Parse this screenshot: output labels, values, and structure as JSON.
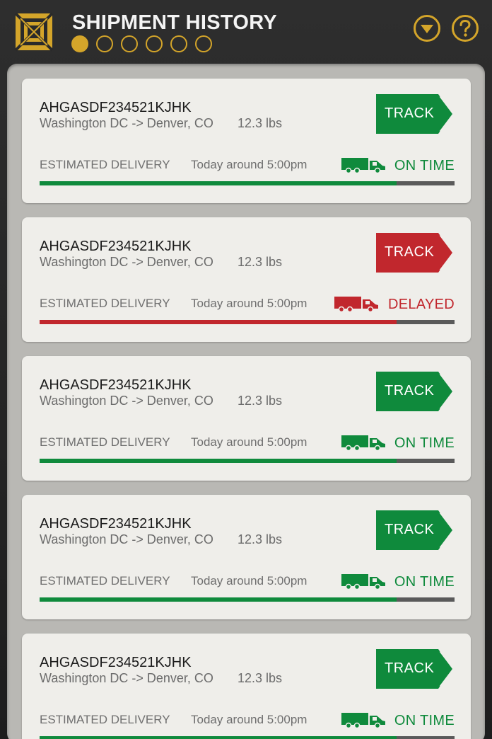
{
  "header": {
    "title": "SHIPMENT HISTORY",
    "logo_icon": "box-logo-icon",
    "page_indicator": {
      "count": 6,
      "active_index": 0
    },
    "dropdown_icon": "chevron-down-circle-icon",
    "help_icon": "question-circle-icon"
  },
  "colors": {
    "accent_gold": "#d4a52a",
    "on_time_green": "#0f8a3c",
    "delayed_red": "#c1272d",
    "progress_track": "#5a5a5a"
  },
  "shipments": [
    {
      "id": "AHGASDF234521KJHK",
      "route": "Washington DC -> Denver, CO",
      "weight": "12.3 lbs",
      "track_label": "TRACK",
      "est_label": "ESTIMATED DELIVERY",
      "est_time": "Today around 5:00pm",
      "status": "ON TIME",
      "status_kind": "on_time",
      "truck_icon": "truck-icon",
      "progress": 0.86
    },
    {
      "id": "AHGASDF234521KJHK",
      "route": "Washington DC -> Denver, CO",
      "weight": "12.3 lbs",
      "track_label": "TRACK",
      "est_label": "ESTIMATED DELIVERY",
      "est_time": "Today around 5:00pm",
      "status": "DELAYED",
      "status_kind": "delayed",
      "truck_icon": "truck-icon",
      "progress": 0.86
    },
    {
      "id": "AHGASDF234521KJHK",
      "route": "Washington DC -> Denver, CO",
      "weight": "12.3 lbs",
      "track_label": "TRACK",
      "est_label": "ESTIMATED DELIVERY",
      "est_time": "Today around 5:00pm",
      "status": "ON TIME",
      "status_kind": "on_time",
      "truck_icon": "truck-icon",
      "progress": 0.86
    },
    {
      "id": "AHGASDF234521KJHK",
      "route": "Washington DC -> Denver, CO",
      "weight": "12.3 lbs",
      "track_label": "TRACK",
      "est_label": "ESTIMATED DELIVERY",
      "est_time": "Today around 5:00pm",
      "status": "ON TIME",
      "status_kind": "on_time",
      "truck_icon": "truck-icon",
      "progress": 0.86
    },
    {
      "id": "AHGASDF234521KJHK",
      "route": "Washington DC -> Denver, CO",
      "weight": "12.3 lbs",
      "track_label": "TRACK",
      "est_label": "ESTIMATED DELIVERY",
      "est_time": "Today around 5:00pm",
      "status": "ON TIME",
      "status_kind": "on_time",
      "truck_icon": "truck-icon",
      "progress": 0.86
    }
  ]
}
